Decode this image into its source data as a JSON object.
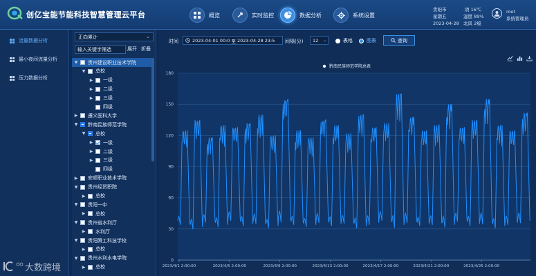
{
  "app": {
    "title": "创亿宝能节能科技智慧管理云平台"
  },
  "nav": [
    {
      "label": "概览",
      "icon": "grid-icon"
    },
    {
      "label": "实时监控",
      "icon": "monitor-icon"
    },
    {
      "label": "数据分析",
      "icon": "analysis-icon",
      "active": true
    },
    {
      "label": "系统设置",
      "icon": "settings-icon"
    }
  ],
  "header_info": {
    "city": "贵阳市",
    "weekday": "星期五",
    "date": "2023-04-28",
    "weather": "阴",
    "temperature": "16℃",
    "humidity": "湿度 89%",
    "wind": "北风 2级",
    "username": "root",
    "role": "系统管理员"
  },
  "sidebar": {
    "items": [
      {
        "label": "流量数据分析",
        "active": true
      },
      {
        "label": "最小夜间流量分析"
      },
      {
        "label": "压力数据分析"
      }
    ]
  },
  "tree_panel": {
    "mode_value": "正向累计",
    "search_placeholder": "输入关键字筛选",
    "expand_label": "展开",
    "collapse_label": "折叠",
    "nodes": [
      {
        "label": "贵州建设职业技术学院",
        "level": 0,
        "arrow": "▼",
        "check": "none",
        "selected": true
      },
      {
        "label": "总校",
        "level": 1,
        "arrow": "▼",
        "check": "none"
      },
      {
        "label": "一级",
        "level": 2,
        "arrow": "▶",
        "check": "none"
      },
      {
        "label": "二级",
        "level": 2,
        "arrow": "▶",
        "check": "none"
      },
      {
        "label": "三级",
        "level": 2,
        "arrow": "▶",
        "check": "none"
      },
      {
        "label": "四级",
        "level": 2,
        "arrow": "",
        "check": "none"
      },
      {
        "label": "遵义医科大学",
        "level": 0,
        "arrow": "▶",
        "check": "none"
      },
      {
        "label": "黔南民族师范学院",
        "level": 0,
        "arrow": "▼",
        "check": "partial"
      },
      {
        "label": "总校",
        "level": 1,
        "arrow": "▼",
        "check": "partial"
      },
      {
        "label": "一级",
        "level": 2,
        "arrow": "▶",
        "check": "checked"
      },
      {
        "label": "二级",
        "level": 2,
        "arrow": "▶",
        "check": "none"
      },
      {
        "label": "三级",
        "level": 2,
        "arrow": "▶",
        "check": "none"
      },
      {
        "label": "四级",
        "level": 2,
        "arrow": "",
        "check": "none"
      },
      {
        "label": "安顺职业技术学院",
        "level": 0,
        "arrow": "▶",
        "check": "none"
      },
      {
        "label": "贵州经贸职院",
        "level": 0,
        "arrow": "▼",
        "check": "none"
      },
      {
        "label": "总校",
        "level": 1,
        "arrow": "▶",
        "check": "none"
      },
      {
        "label": "贵阳一中",
        "level": 0,
        "arrow": "▼",
        "check": "none"
      },
      {
        "label": "总校",
        "level": 1,
        "arrow": "▶",
        "check": "none"
      },
      {
        "label": "贵州省水利厅",
        "level": 0,
        "arrow": "▼",
        "check": "none"
      },
      {
        "label": "水利厅",
        "level": 1,
        "arrow": "▶",
        "check": "none"
      },
      {
        "label": "贵阳腾工科技学校",
        "level": 0,
        "arrow": "▼",
        "check": "none"
      },
      {
        "label": "总校",
        "level": 1,
        "arrow": "▶",
        "check": "none"
      },
      {
        "label": "贵州水利水电学院",
        "level": 0,
        "arrow": "▼",
        "check": "none"
      },
      {
        "label": "总校",
        "level": 1,
        "arrow": "▶",
        "check": "none"
      }
    ]
  },
  "filters": {
    "time_label": "时间",
    "start": "2023-04-01 00:0",
    "separator": "至",
    "end": "2023-04-28 23:5",
    "interval_label": "间隔(分)",
    "interval_value": "12",
    "table_label": "表格",
    "chart_label": "图表",
    "query_label": "查询"
  },
  "toolbar_icons": [
    "line-chart-icon",
    "bar-chart-icon",
    "download-icon"
  ],
  "watermark": {
    "text": "大数跨境"
  },
  "chart_data": {
    "type": "line",
    "legend": [
      "黔南民族师范学院总表"
    ],
    "legend_position": "top-center",
    "ylim": [
      0,
      180
    ],
    "yticks": [
      0,
      30,
      60,
      90,
      120,
      150,
      180
    ],
    "xticks": [
      "2023/4/1 2:00:00",
      "2023/4/5 2:00:00",
      "2023/4/9 2:00:00",
      "2023/4/13 2:00:00",
      "2023/4/17 2:00:00",
      "2023/4/21 2:00:00",
      "2023/4/25 2:00:00"
    ],
    "grid": true,
    "color": "#1f8fff",
    "daily_peaks": [
      125,
      135,
      118,
      130,
      128,
      132,
      140,
      120,
      155,
      125,
      118,
      135,
      130,
      122,
      140,
      128,
      132,
      160,
      138,
      125,
      130,
      150,
      128,
      135,
      155,
      130,
      125,
      142
    ],
    "daily_troughs": [
      36,
      32,
      38,
      34,
      40,
      35,
      37,
      33,
      39,
      36,
      34,
      38,
      35,
      37,
      33,
      36,
      40,
      34,
      38,
      35,
      36,
      34,
      39,
      35,
      37,
      33,
      36,
      38
    ]
  }
}
